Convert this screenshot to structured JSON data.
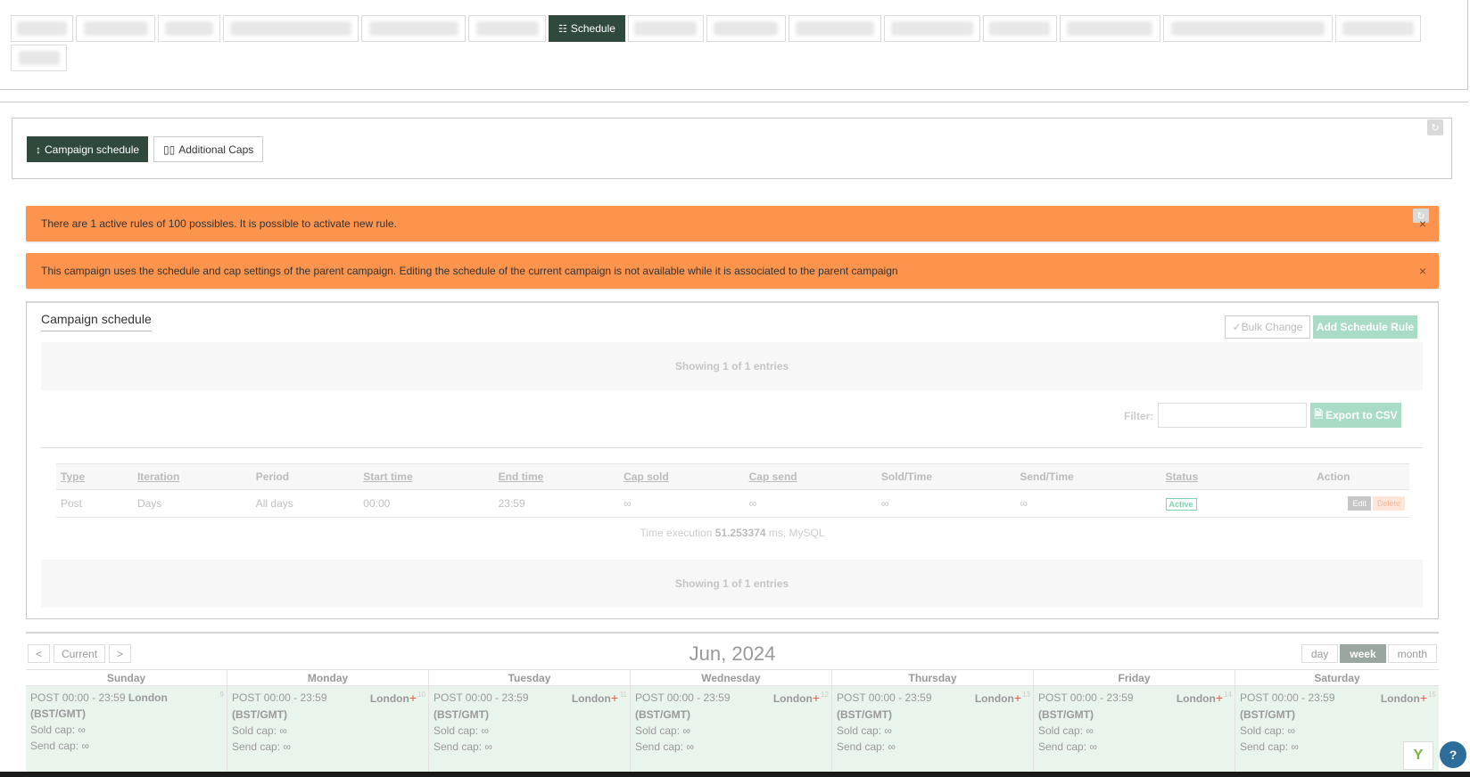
{
  "nav": {
    "active_label": "Schedule",
    "active_icon": "calendar-icon"
  },
  "schedule_tabs": {
    "campaign_schedule": "Campaign schedule",
    "additional_caps": "Additional Caps"
  },
  "alerts": {
    "rules": "There are 1 active rules of 100 possibles. It is possible to activate new rule.",
    "parent": "This campaign uses the schedule and cap settings of the parent campaign. Editing the schedule of the current campaign is not available while it is associated to the parent campaign",
    "close_glyph": "×"
  },
  "schedule": {
    "title": "Campaign schedule",
    "bulk_change": "Bulk Change",
    "add_rule": "Add Schedule Rule",
    "showing_top": "Showing 1 of 1 entries",
    "showing_bottom": "Showing 1 of 1 entries",
    "filter_label": "Filter:",
    "export_csv": "Export to CSV",
    "columns": [
      "Type",
      "Iteration",
      "Period",
      "Start time",
      "End time",
      "Cap sold",
      "Cap send",
      "Sold/Time",
      "Send/Time",
      "Status",
      "Action"
    ],
    "row": {
      "type": "Post",
      "iteration": "Days",
      "period": "All days",
      "start_time": "00:00",
      "end_time": "23:59",
      "cap_sold": "∞",
      "cap_send": "∞",
      "sold_time": "∞",
      "send_time": "∞",
      "status": "Active",
      "edit": "Edit",
      "delete": "Delete"
    },
    "time_exec_prefix": "Time execution",
    "time_exec_value": "51.253374",
    "time_exec_suffix": "ms, MySQL"
  },
  "calendar": {
    "prev": "<",
    "current": "Current",
    "next": ">",
    "title": "Jun, 2024",
    "views": [
      "day",
      "week",
      "month"
    ],
    "active_view": "week",
    "days": [
      {
        "name": "Sunday",
        "num": "9",
        "rule": "POST 00:00 - 23:59",
        "tz": "London (BST/GMT)",
        "sold": "Sold cap: ∞",
        "send": "Send cap: ∞"
      },
      {
        "name": "Monday",
        "num": "10",
        "rule": "POST 00:00 - 23:59",
        "tz": "London",
        "tz2": "(BST/GMT)",
        "sold": "Sold cap: ∞",
        "send": "Send cap: ∞"
      },
      {
        "name": "Tuesday",
        "num": "11",
        "rule": "POST 00:00 - 23:59",
        "tz": "London",
        "tz2": "(BST/GMT)",
        "sold": "Sold cap: ∞",
        "send": "Send cap: ∞"
      },
      {
        "name": "Wednesday",
        "num": "12",
        "rule": "POST 00:00 - 23:59",
        "tz": "London",
        "tz2": "(BST/GMT)",
        "sold": "Sold cap: ∞",
        "send": "Send cap: ∞"
      },
      {
        "name": "Thursday",
        "num": "13",
        "rule": "POST 00:00 - 23:59",
        "tz": "London",
        "tz2": "(BST/GMT)",
        "sold": "Sold cap: ∞",
        "send": "Send cap: ∞"
      },
      {
        "name": "Friday",
        "num": "14",
        "rule": "POST 00:00 - 23:59",
        "tz": "London",
        "tz2": "(BST/GMT)",
        "sold": "Sold cap: ∞",
        "send": "Send cap: ∞"
      },
      {
        "name": "Saturday",
        "num": "15",
        "rule": "POST 00:00 - 23:59",
        "tz": "London",
        "tz2": "(BST/GMT)",
        "sold": "Sold cap: ∞",
        "send": "Send cap: ∞"
      }
    ]
  },
  "colors": {
    "primary": "#2f4a3b",
    "alert": "#fc944e",
    "accent_light": "#a9dcc4",
    "calendar_event": "#e9f5ea"
  }
}
